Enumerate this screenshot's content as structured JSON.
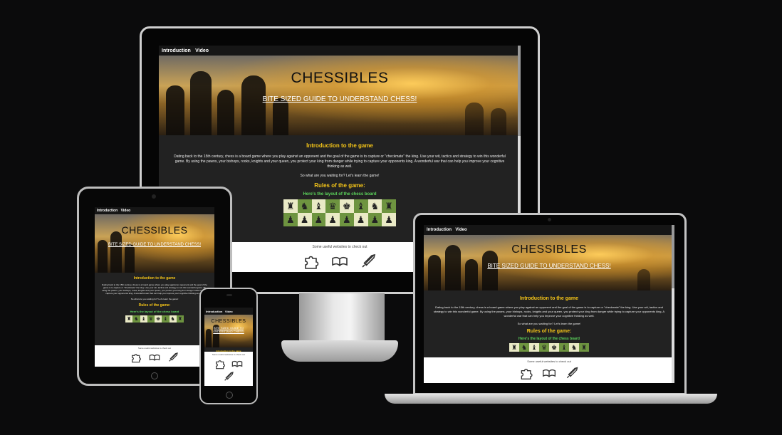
{
  "site": {
    "nav": [
      "Introduction",
      "Video"
    ],
    "title": "CHESSIBLES",
    "tagline": "BITE SIZED GUIDE TO UNDERSTAND CHESS!",
    "intro_heading": "Introduction to the game",
    "intro_text": "Dating back to the 15th century, chess is a board game where you play against an opponent and the goal of the game is to capture or \"checkmate\" the king. Use your wit, tactics and strategy to win this wonderful game. By using the pawns, your bishops, rooks, knights and your queen, you protect your king from danger while trying to capture your opponents king. A wonderful war that can help you improve your cognitive thinking as well.",
    "cta_text": "So what are you waiting for? Let's learn the game!",
    "rules_heading": "Rules of the game:",
    "layout_heading": "Here's the layout of the chess board",
    "footer_text": "Some useful websites to check out",
    "back_rank": [
      "♜",
      "♞",
      "♝",
      "♛",
      "♚",
      "♝",
      "♞",
      "♜"
    ],
    "pawn": "♟",
    "footer_icons": [
      "puzzle-icon",
      "book-icon",
      "sword-icon"
    ]
  },
  "colors": {
    "page_bg": "#222222",
    "heading": "#f5c518",
    "subheading": "#5cd65c",
    "board_dark": "#6e9440",
    "board_light": "#eaeac6"
  }
}
